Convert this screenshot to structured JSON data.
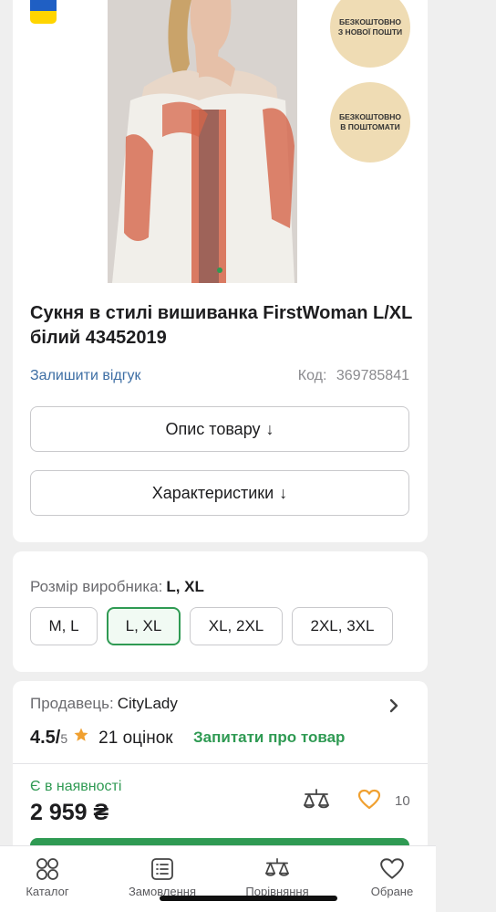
{
  "promos": [
    {
      "text": "БЕЗКОШТОВНО З НОВОЇ ПОШТИ"
    },
    {
      "text": "БЕЗКОШТОВНО В ПОШТОМАТИ"
    }
  ],
  "product": {
    "title": "Сукня в стилі вишиванка FirstWoman L/XL білий 43452019",
    "review_link": "Залишити відгук",
    "code_label": "Код:",
    "code_value": "369785841",
    "description_button": "Опис товару",
    "characteristics_button": "Характеристики",
    "arrow": "↓"
  },
  "sizes": {
    "label": "Розмір виробника:",
    "selected_value": "L, XL",
    "options": [
      "M, L",
      "L, XL",
      "XL, 2XL",
      "2XL, 3XL"
    ],
    "selected_index": 1
  },
  "seller": {
    "label": "Продавець:",
    "name": "CityLady",
    "rating": "4.5/",
    "rating_max": "5",
    "reviews": "21 оцінок",
    "ask": "Запитати про товар",
    "stock": "Є в наявності",
    "price": "2 959 ₴",
    "favorites_count": "10"
  },
  "tabbar": {
    "items": [
      {
        "label": "Каталог",
        "icon": "catalog-icon"
      },
      {
        "label": "Замовлення",
        "icon": "orders-icon"
      },
      {
        "label": "Порівняння",
        "icon": "compare-icon"
      },
      {
        "label": "Обране",
        "icon": "heart-icon"
      }
    ]
  },
  "colors": {
    "accent": "#2f9a53",
    "link": "#3d6ea4",
    "promo": "#efdcb4",
    "heart": "#f0a030",
    "star": "#f0a030"
  }
}
